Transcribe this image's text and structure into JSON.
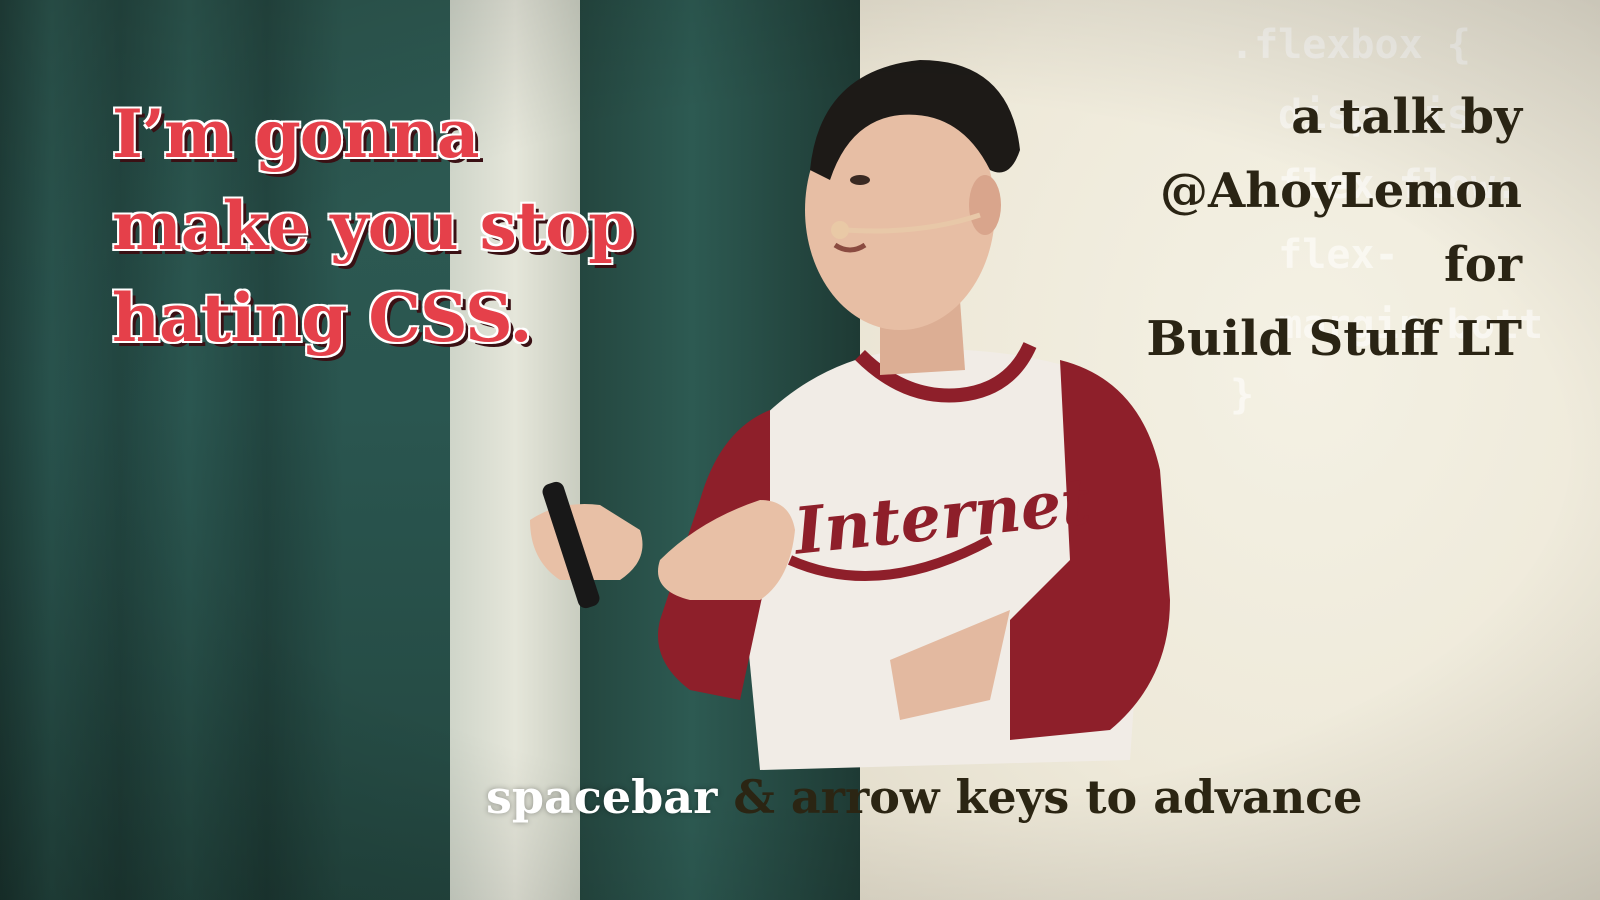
{
  "slide": {
    "title_lines": [
      "I’m gonna",
      "make you stop",
      "hating CSS."
    ],
    "byline_lines": [
      "a talk by",
      "@AhoyLemon",
      "for",
      "Build Stuff LT"
    ],
    "hint": {
      "key": "spacebar",
      "rest": " & arrow keys to advance"
    },
    "shirt_text": "Internet"
  },
  "screen_code": ".flexbox {\n  disp  is\n  flex-flow:\n  flex-\n  margin-bott\n}",
  "colors": {
    "title": "#e5404a",
    "byline": "#2a2414",
    "hint_key": "#ffffff",
    "curtain": "#2d5a52",
    "shirt_sleeve": "#8e1f2a"
  }
}
